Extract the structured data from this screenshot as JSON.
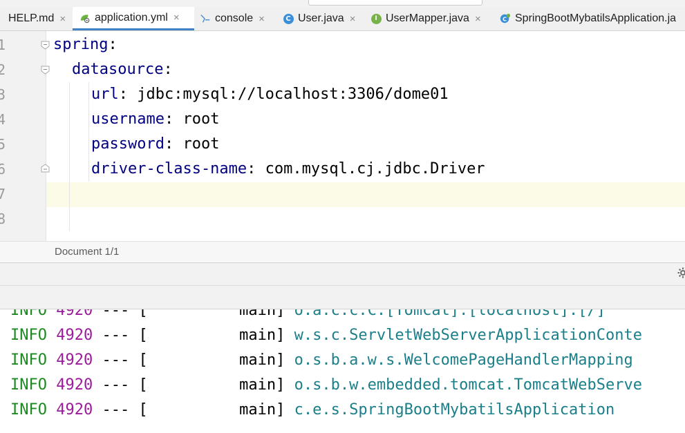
{
  "tabs": [
    {
      "label": "HELP.md",
      "icon": "markdown-icon",
      "active": false
    },
    {
      "label": "application.yml",
      "icon": "spring-config-icon",
      "active": true
    },
    {
      "label": "console",
      "icon": "sql-console-icon",
      "active": false
    },
    {
      "label": "User.java",
      "icon": "class-icon",
      "active": false
    },
    {
      "label": "UserMapper.java",
      "icon": "interface-icon",
      "active": false
    },
    {
      "label": "SpringBootMybatilsApplication.ja",
      "icon": "spring-boot-class-icon",
      "active": false
    }
  ],
  "tab_close_glyph": "×",
  "editor": {
    "line_numbers": [
      "1",
      "2",
      "3",
      "4",
      "5",
      "6",
      "7",
      "8"
    ],
    "lines": [
      {
        "key": "spring",
        "sep": ":",
        "value": ""
      },
      {
        "key": "datasource",
        "sep": ":",
        "value": ""
      },
      {
        "key": "url",
        "sep": ": ",
        "value": "jdbc:mysql://localhost:3306/dome01"
      },
      {
        "key": "username",
        "sep": ": ",
        "value": "root"
      },
      {
        "key": "password",
        "sep": ": ",
        "value": "root"
      },
      {
        "key": "driver-class-name",
        "sep": ": ",
        "value": "com.mysql.cj.jdbc.Driver"
      }
    ]
  },
  "breadcrumb": "Document 1/1",
  "console": {
    "lines": [
      {
        "level": "INFO",
        "pid": "4920",
        "sep": "---",
        "bracket": "[",
        "thread": "main]",
        "logger": "o.a.c.c.C.[Tomcat].[localhost].[/]"
      },
      {
        "level": "INFO",
        "pid": "4920",
        "sep": "---",
        "bracket": "[",
        "thread": "main]",
        "logger": "w.s.c.ServletWebServerApplicationConte"
      },
      {
        "level": "INFO",
        "pid": "4920",
        "sep": "---",
        "bracket": "[",
        "thread": "main]",
        "logger": "o.s.b.a.w.s.WelcomePageHandlerMapping"
      },
      {
        "level": "INFO",
        "pid": "4920",
        "sep": "---",
        "bracket": "[",
        "thread": "main]",
        "logger": "o.s.b.w.embedded.tomcat.TomcatWebServe"
      },
      {
        "level": "INFO",
        "pid": "4920",
        "sep": "---",
        "bracket": "[",
        "thread": "main]",
        "logger": "c.e.s.SpringBootMybatilsApplication"
      }
    ]
  },
  "colors": {
    "yaml_key": "#000080",
    "log_level": "#1c8a20",
    "log_pid": "#9b1c9b",
    "log_logger": "#1b7f8a",
    "active_tab_underline": "#4083c9",
    "caret_line": "#fcfbe7"
  }
}
